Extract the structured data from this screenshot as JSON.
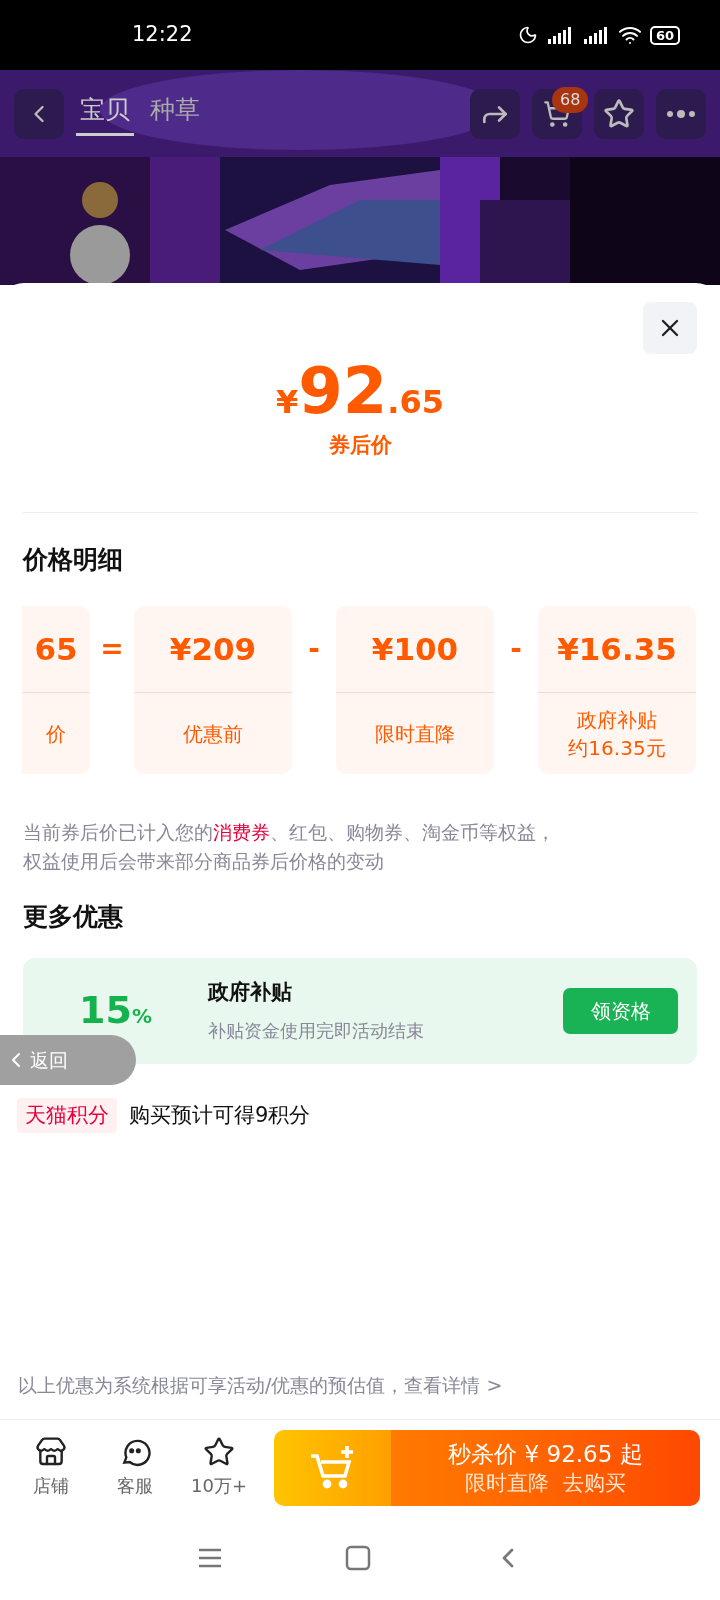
{
  "status_bar": {
    "time": "12:22",
    "battery": "60"
  },
  "nav": {
    "tabs": [
      {
        "label": "宝贝",
        "selected": true
      },
      {
        "label": "种草",
        "selected": false
      }
    ],
    "cart_count": "68"
  },
  "sheet": {
    "price": {
      "currency": "¥",
      "integer": "92",
      "decimal": ".65",
      "caption": "券后价"
    },
    "breakdown_title": "价格明细",
    "breakdown": [
      {
        "amount": "65",
        "labels": [
          "价"
        ],
        "operator": "="
      },
      {
        "amount": "¥209",
        "labels": [
          "优惠前"
        ],
        "operator": "-"
      },
      {
        "amount": "¥100",
        "labels": [
          "限时直降"
        ],
        "operator": "-"
      },
      {
        "amount": "¥16.35",
        "labels": [
          "政府补贴",
          "约16.35元"
        ]
      }
    ],
    "note_lines": [
      "当前券后价已计入您的**消费券**、红包、购物券、淘金币等权益，",
      "权益使用后会带来部分商品券后价格的变动"
    ],
    "more_title": "更多优惠",
    "offer": {
      "percent": "15",
      "unit": "%",
      "title": "政府补贴",
      "subtitle": "补贴资金使用完即活动结束",
      "button": "领资格"
    },
    "points": {
      "tag": "天猫积分",
      "text": "购买预计可得9积分"
    },
    "footer_note": "以上优惠为系统根据可享活动/优惠的预估值，查看详情 >"
  },
  "back_pill": "返回",
  "bottom_bar": {
    "items": [
      {
        "kind": "store",
        "label": "店铺"
      },
      {
        "kind": "service",
        "label": "客服"
      },
      {
        "kind": "star",
        "label": "10万+"
      }
    ],
    "buy": {
      "line1": "秒杀价 ¥ 92.65 起",
      "line2": "限时直降  去购买"
    }
  }
}
